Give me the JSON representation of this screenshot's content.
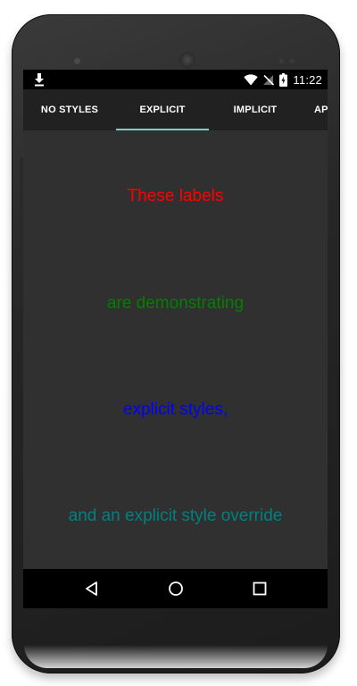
{
  "status_bar": {
    "time": "11:22",
    "icons": [
      "download-icon",
      "wifi-icon",
      "no-signal-icon",
      "battery-charging-icon"
    ]
  },
  "tabs": [
    {
      "label": "NO STYLES",
      "selected": false
    },
    {
      "label": "EXPLICIT",
      "selected": true
    },
    {
      "label": "IMPLICIT",
      "selected": false
    },
    {
      "label": "AP",
      "selected": false
    }
  ],
  "labels": [
    {
      "text": "These labels",
      "color": "#ff0000"
    },
    {
      "text": "are demonstrating",
      "color": "#008000"
    },
    {
      "text": "explicit styles,",
      "color": "#0000ff"
    },
    {
      "text": "and an explicit style override",
      "color": "#008080"
    }
  ],
  "navigation": {
    "icons": [
      "back-icon",
      "home-icon",
      "recents-icon"
    ]
  },
  "colors": {
    "background": "#303030",
    "tab_bar": "#212121",
    "tab_indicator": "#80cbc4"
  }
}
